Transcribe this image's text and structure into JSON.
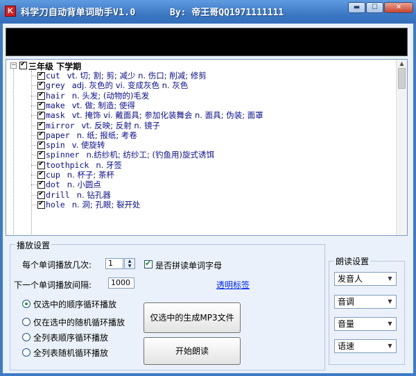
{
  "window": {
    "title": "科学刀自动背单词助手V1.0",
    "author": "By: 帝王哥QQ1971111111",
    "minimize": "▬",
    "maximize": "☐",
    "close": "✕"
  },
  "tree": {
    "root_label": "三年级 下学期",
    "root_expanded_symbol": "−",
    "items": [
      {
        "word": "cut",
        "meaning": "vt. 切; 割; 剪; 减少 n. 伤口; 削减; 修剪"
      },
      {
        "word": "grey",
        "meaning": "adj. 灰色的 vi. 变成灰色 n. 灰色"
      },
      {
        "word": "hair",
        "meaning": "n. 头发; (动物的)毛发"
      },
      {
        "word": "make",
        "meaning": "vt. 做; 制造; 使得"
      },
      {
        "word": "mask",
        "meaning": "vt. 掩饰 vi. 戴面具; 参加化装舞会 n. 面具; 伪装; 面罩"
      },
      {
        "word": "mirror",
        "meaning": "vt. 反映; 反射 n. 镜子"
      },
      {
        "word": "paper",
        "meaning": "n. 纸; 报纸; 考卷"
      },
      {
        "word": "spin",
        "meaning": "v. 使旋转"
      },
      {
        "word": "spinner",
        "meaning": "n.纺纱机; 纺纱工; (钓鱼用)旋式诱饵"
      },
      {
        "word": "toothpick",
        "meaning": "n. 牙签"
      },
      {
        "word": "cup",
        "meaning": "n. 杯子; 茶杯"
      },
      {
        "word": "dot",
        "meaning": "n. 小圆点"
      },
      {
        "word": "drill",
        "meaning": "n. 钻孔器"
      },
      {
        "word": "hole",
        "meaning": "n. 洞; 孔眼; 裂开处"
      }
    ]
  },
  "playback": {
    "group_title": "播放设置",
    "repeat_label": "每个单词播放几次:",
    "repeat_value": "1",
    "spell_label": "是否拼读单词字母",
    "interval_label": "下一个单词播放间隔:",
    "interval_value": "1000",
    "transparent_link": "透明标签",
    "modes": [
      {
        "label": "仅选中的顺序循环播放",
        "selected": true
      },
      {
        "label": "仅在选中的随机循环播放",
        "selected": false
      },
      {
        "label": "全列表顺序循环播放",
        "selected": false
      },
      {
        "label": "全列表随机循环播放",
        "selected": false
      }
    ],
    "gen_mp3_button": "仅选中的生成MP3文件",
    "start_button": "开始朗读"
  },
  "reading": {
    "group_title": "朗读设置",
    "combos": [
      "发音人",
      "音调",
      "音量",
      "语速"
    ]
  }
}
